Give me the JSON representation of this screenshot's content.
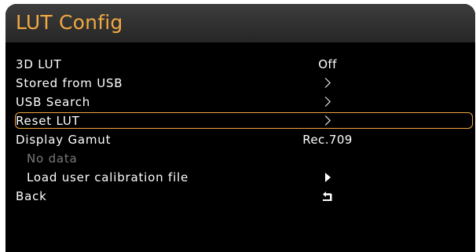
{
  "window": {
    "title": "LUT Config"
  },
  "colors": {
    "accent": "#f0a841",
    "background": "#000000",
    "text": "#ffffff",
    "disabled": "#7a7a7a"
  },
  "menu": {
    "items": [
      {
        "label": "3D LUT",
        "value": "Off"
      },
      {
        "label": "Stored from USB",
        "icon": "chevron-right-icon"
      },
      {
        "label": "USB Search",
        "icon": "chevron-right-icon"
      },
      {
        "label": "Reset LUT",
        "icon": "chevron-right-icon",
        "selected": true
      },
      {
        "label": "Display Gamut",
        "value": "Rec.709"
      },
      {
        "label": "No data",
        "disabled": true
      },
      {
        "label": "Load user calibration file",
        "icon": "play-triangle-icon"
      },
      {
        "label": "Back",
        "icon": "return-icon"
      }
    ]
  }
}
